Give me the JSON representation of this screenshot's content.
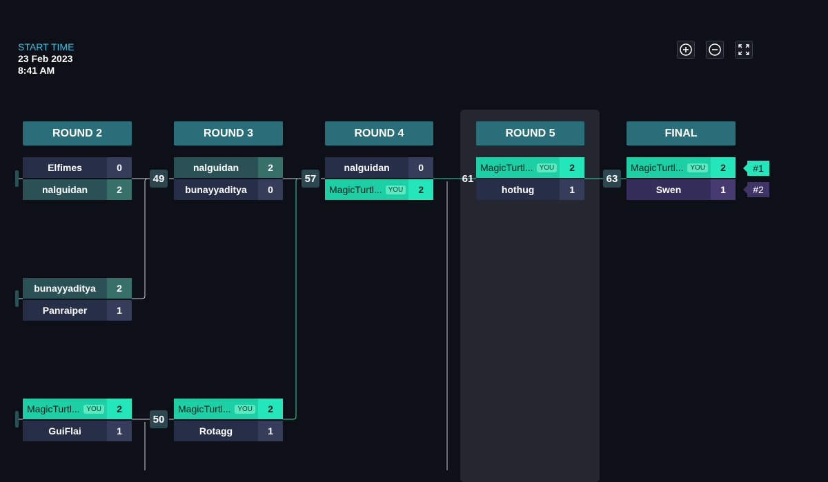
{
  "start_time": {
    "label": "START TIME",
    "date": "23 Feb 2023",
    "time": "8:41 AM"
  },
  "controls": {
    "zoom_in": "zoom-in-icon",
    "zoom_out": "zoom-out-icon",
    "fullscreen": "fullscreen-icon"
  },
  "rounds": [
    "ROUND 2",
    "ROUND 3",
    "ROUND 4",
    "ROUND 5",
    "FINAL"
  ],
  "you_badge": "YOU",
  "colors": {
    "you": "#1ccfa4",
    "header": "#2a6e7a",
    "line": "#2fd3a8",
    "highlight_col": "#252730"
  },
  "match_numbers": {
    "m49": "49",
    "m50": "50",
    "m57": "57",
    "m61": "61",
    "m63": "63"
  },
  "matches": {
    "r2m1": {
      "p1": {
        "name": "Elfimes",
        "score": "0"
      },
      "p2": {
        "name": "nalguidan",
        "score": "2"
      }
    },
    "r2m2": {
      "p1": {
        "name": "bunayyaditya",
        "score": "2"
      },
      "p2": {
        "name": "Panraiper",
        "score": "1"
      }
    },
    "r2m3": {
      "p1": {
        "name": "MagicTurtl...",
        "score": "2"
      },
      "p2": {
        "name": "GuiFlai",
        "score": "1"
      }
    },
    "r3m1": {
      "p1": {
        "name": "nalguidan",
        "score": "2"
      },
      "p2": {
        "name": "bunayyaditya",
        "score": "0"
      }
    },
    "r3m2": {
      "p1": {
        "name": "MagicTurtl...",
        "score": "2"
      },
      "p2": {
        "name": "Rotagg",
        "score": "1"
      }
    },
    "r4m1": {
      "p1": {
        "name": "nalguidan",
        "score": "0"
      },
      "p2": {
        "name": "MagicTurtl...",
        "score": "2"
      }
    },
    "r5m1": {
      "p1": {
        "name": "MagicTurtl...",
        "score": "2"
      },
      "p2": {
        "name": "hothug",
        "score": "1"
      }
    },
    "final": {
      "p1": {
        "name": "MagicTurtl...",
        "score": "2"
      },
      "p2": {
        "name": "Swen",
        "score": "1"
      }
    }
  },
  "ranks": {
    "first": "#1",
    "second": "#2"
  }
}
